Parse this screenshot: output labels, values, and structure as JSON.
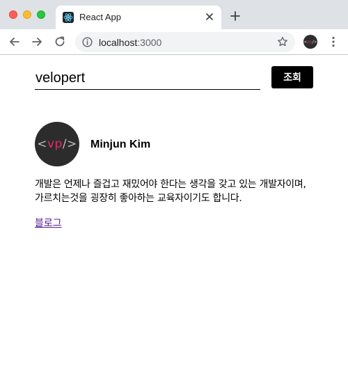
{
  "window": {
    "traffic_lights": [
      "close",
      "minimize",
      "zoom"
    ]
  },
  "tab": {
    "title": "React App",
    "favicon": "react-logo-icon"
  },
  "toolbar": {
    "url_host": "localhost",
    "url_port": ":3000"
  },
  "profile": {
    "badge_open": "<",
    "badge_mark": "vp",
    "badge_close": "/>"
  },
  "search": {
    "value": "velopert",
    "button_label": "조회"
  },
  "user": {
    "avatar_open": "<",
    "avatar_mark": "vp",
    "avatar_close": "/>",
    "name": "Minjun Kim",
    "bio": "개발은 언제나 즐겁고 재밌어야 한다는 생각을 갖고 있는 개발자이며, 가르치는것을 굉장히 좋아하는 교육자이기도 합니다.",
    "blog_link_label": "블로그"
  },
  "colors": {
    "chrome_bg": "#dee1e6",
    "accent_pink": "#e6296b",
    "link": "#551a8b"
  }
}
